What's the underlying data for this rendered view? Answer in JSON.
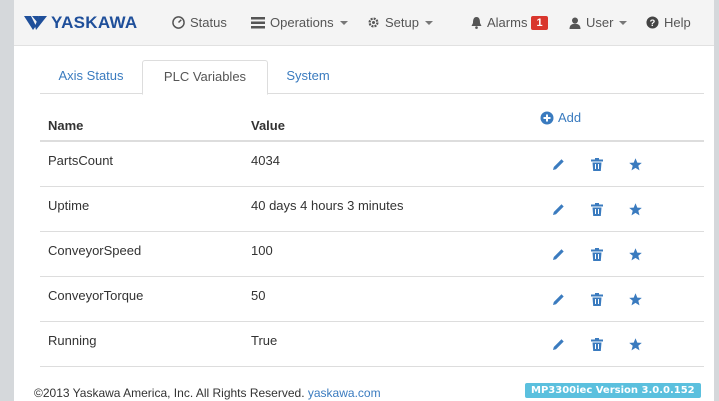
{
  "brand": {
    "name": "YASKAWA",
    "color": "#1f4f9a"
  },
  "nav": {
    "status": {
      "label": "Status",
      "icon": "dashboard-icon"
    },
    "operations": {
      "label": "Operations",
      "icon": "list-icon"
    },
    "setup": {
      "label": "Setup",
      "icon": "gear-icon"
    },
    "alarms": {
      "label": "Alarms",
      "icon": "bell-icon",
      "count": "1"
    },
    "user": {
      "label": "User",
      "icon": "user-icon"
    },
    "help": {
      "label": "Help",
      "icon": "question-icon"
    }
  },
  "tabs": [
    {
      "label": "Axis Status",
      "active": false
    },
    {
      "label": "PLC Variables",
      "active": true
    },
    {
      "label": "System",
      "active": false
    }
  ],
  "table": {
    "headers": {
      "name": "Name",
      "value": "Value"
    },
    "add_label": "Add",
    "rows": [
      {
        "name": "PartsCount",
        "value": "4034"
      },
      {
        "name": "Uptime",
        "value": "40 days 4 hours 3 minutes"
      },
      {
        "name": "ConveyorSpeed",
        "value": "100"
      },
      {
        "name": "ConveyorTorque",
        "value": "50"
      },
      {
        "name": "Running",
        "value": "True"
      }
    ],
    "row_actions": [
      "pencil-icon",
      "trash-icon",
      "star-icon"
    ]
  },
  "footer": {
    "copyright": "©2013 Yaskawa America, Inc. All Rights Reserved.",
    "link": "yaskawa.com",
    "version": "MP3300iec Version 3.0.0.152"
  },
  "colors": {
    "link": "#3a7bbf",
    "alarm": "#d9362d",
    "version_badge": "#5bc0de"
  }
}
